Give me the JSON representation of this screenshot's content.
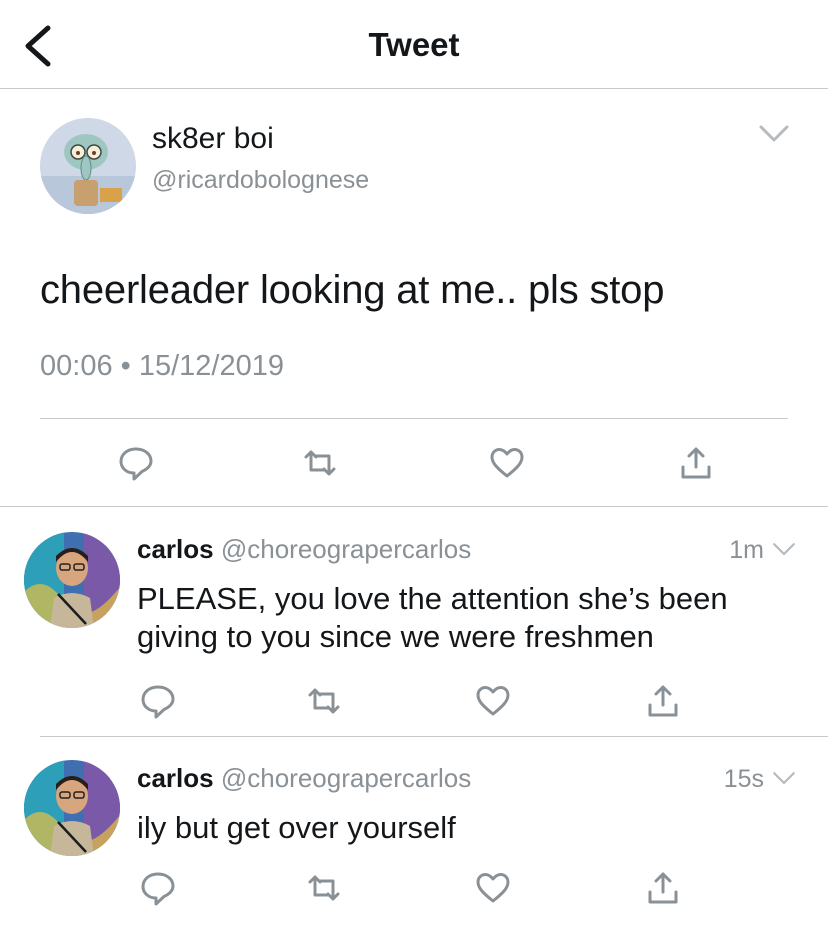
{
  "header": {
    "title": "Tweet"
  },
  "main_tweet": {
    "display_name": "sk8er boi",
    "handle": "@ricardobolognese",
    "text": "cheerleader looking at me.. pls stop",
    "timestamp": "00:06 • 15/12/2019"
  },
  "replies": [
    {
      "display_name": "carlos",
      "handle": "@choreograpercarlos",
      "time": "1m",
      "text": "PLEASE, you love the attention she’s been giving to you since we were freshmen"
    },
    {
      "display_name": "carlos",
      "handle": "@choreograpercarlos",
      "time": "15s",
      "text": "ily but get over yourself"
    }
  ],
  "colors": {
    "text": "#14171a",
    "secondary": "#8a9196",
    "divider": "#c8c8cc",
    "icon": "#8a9196"
  },
  "icons": [
    "back-chevron-icon",
    "chevron-down-icon",
    "reply-icon",
    "retweet-icon",
    "like-icon",
    "share-icon"
  ]
}
